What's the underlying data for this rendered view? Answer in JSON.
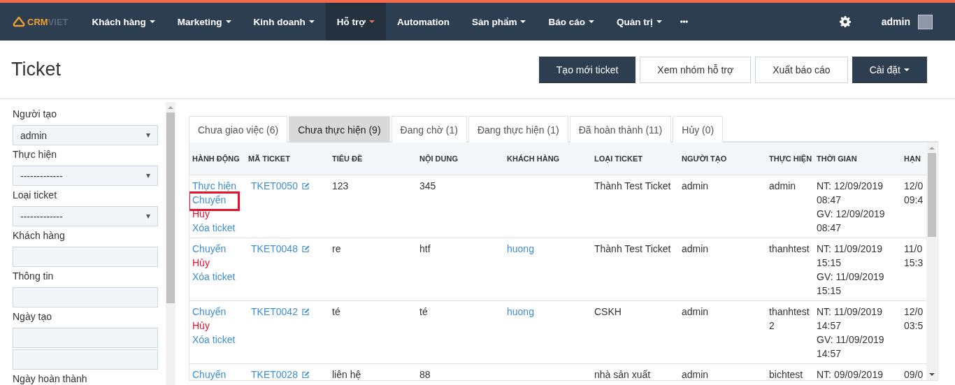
{
  "navbar": {
    "logo": {
      "brand": "CRM",
      "brand_suffix": "VIET"
    },
    "items": [
      {
        "label": "Khách hàng",
        "dropdown": true,
        "selected": false
      },
      {
        "label": "Marketing",
        "dropdown": true,
        "selected": false
      },
      {
        "label": "Kinh doanh",
        "dropdown": true,
        "selected": false
      },
      {
        "label": "Hỗ trợ",
        "dropdown": true,
        "selected": true
      },
      {
        "label": "Automation",
        "dropdown": false,
        "selected": false
      },
      {
        "label": "Sản phẩm",
        "dropdown": true,
        "selected": false
      },
      {
        "label": "Báo cáo",
        "dropdown": true,
        "selected": false
      },
      {
        "label": "Quản trị",
        "dropdown": true,
        "selected": false
      }
    ],
    "user": "admin"
  },
  "page_title": "Ticket",
  "buttons": [
    {
      "label": "Tạo mới ticket",
      "kind": "primary",
      "dropdown": false
    },
    {
      "label": "Xem nhóm hỗ trợ",
      "kind": "default",
      "dropdown": false
    },
    {
      "label": "Xuất báo cáo",
      "kind": "default",
      "dropdown": false
    },
    {
      "label": "Cài đặt",
      "kind": "primary",
      "dropdown": true
    }
  ],
  "filters": [
    {
      "label": "Người tạo",
      "fields": [
        {
          "kind": "select",
          "value": "admin"
        }
      ]
    },
    {
      "label": "Thực hiện",
      "fields": [
        {
          "kind": "select",
          "value": "-------------"
        }
      ]
    },
    {
      "label": "Loại ticket",
      "fields": [
        {
          "kind": "select",
          "value": "-------------"
        }
      ]
    },
    {
      "label": "Khách hàng",
      "fields": [
        {
          "kind": "input"
        }
      ]
    },
    {
      "label": "Thông tin",
      "fields": [
        {
          "kind": "input"
        }
      ]
    },
    {
      "label": "Ngày tạo",
      "fields": [
        {
          "kind": "input"
        },
        {
          "kind": "input"
        }
      ]
    },
    {
      "label": "Ngày hoàn thành"
    }
  ],
  "tabs": [
    {
      "label": "Chưa giao việc (6)",
      "selected": false
    },
    {
      "label": "Chưa thực hiện (9)",
      "selected": true
    },
    {
      "label": "Đang chờ (1)",
      "selected": false
    },
    {
      "label": "Đang thực hiện (1)",
      "selected": false
    },
    {
      "label": "Đã hoàn thành (11)",
      "selected": false
    },
    {
      "label": "Hủy (0)",
      "selected": false
    }
  ],
  "table": {
    "columns": [
      "HÀNH ĐỘNG",
      "MÃ TICKET",
      "TIÊU ĐỀ",
      "NỘI DUNG",
      "KHÁCH HÀNG",
      "LOẠI TICKET",
      "NGƯỜI TẠO",
      "THỰC HIỆN",
      "THỜI GIAN",
      "HẠN"
    ],
    "rows": [
      {
        "actions": [
          {
            "label": "Thực hiện",
            "kind": "link",
            "highlighted": false
          },
          {
            "label": "Chuyển",
            "kind": "link",
            "highlighted": true
          },
          {
            "label": "Hủy",
            "kind": "danger",
            "highlighted": false
          },
          {
            "label": "Xóa ticket",
            "kind": "link",
            "highlighted": false
          }
        ],
        "code": "TKET0050",
        "title": "123",
        "content": "345",
        "type": "Thành Test Ticket",
        "creator": "admin",
        "assignee": "admin",
        "time": [
          "NT: 12/09/2019",
          "08:47",
          "GV: 12/09/2019",
          "08:47"
        ],
        "deadline": [
          "12/0",
          "09:4"
        ]
      },
      {
        "actions": [
          {
            "label": "Chuyển",
            "kind": "link",
            "highlighted": false
          },
          {
            "label": "Hủy",
            "kind": "danger",
            "highlighted": false
          },
          {
            "label": "Xóa ticket",
            "kind": "link",
            "highlighted": false
          }
        ],
        "code": "TKET0048",
        "title": "re",
        "content": "htf",
        "customer": "huong",
        "type": "Thành Test Ticket",
        "creator": "admin",
        "assignee": "thanhtest",
        "time": [
          "NT: 11/09/2019",
          "15:15",
          "GV: 11/09/2019",
          "15:15"
        ],
        "deadline": [
          "11/0",
          "15:3"
        ]
      },
      {
        "actions": [
          {
            "label": "Chuyển",
            "kind": "link",
            "highlighted": false
          },
          {
            "label": "Hủy",
            "kind": "danger",
            "highlighted": false
          },
          {
            "label": "Xóa ticket",
            "kind": "link",
            "highlighted": false
          }
        ],
        "code": "TKET0042",
        "title": "té",
        "content": "té",
        "customer": "huong",
        "type": "CSKH",
        "creator": "admin",
        "assignee": "thanhtest 2",
        "time": [
          "NT: 11/09/2019",
          "14:57",
          "GV: 11/09/2019",
          "14:57"
        ],
        "deadline": [
          "12/0",
          "03:5"
        ]
      },
      {
        "actions": [
          {
            "label": "Chuyển",
            "kind": "link",
            "highlighted": false
          }
        ],
        "code": "TKET0028",
        "title": "liên hệ",
        "content": "88",
        "type": "nhà sản xuất",
        "creator": "admin",
        "assignee": "bichtest",
        "time": [
          "NT: 09/09/2019"
        ],
        "deadline": [
          "09/0"
        ]
      }
    ]
  }
}
